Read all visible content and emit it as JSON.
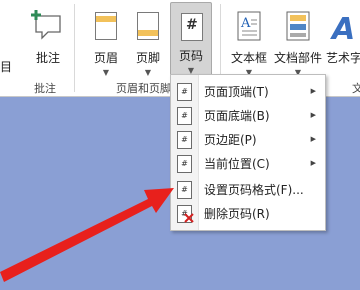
{
  "ribbon": {
    "left_cut_label": "目",
    "comment_btn": {
      "label": "批注"
    },
    "header_btn": {
      "label": "页眉"
    },
    "footer_btn": {
      "label": "页脚"
    },
    "pageno_btn": {
      "label": "页码",
      "icon_text": "#"
    },
    "textbox_btn": {
      "label": "文本框"
    },
    "docparts_btn": {
      "label": "文档部件"
    },
    "wordart_btn": {
      "label": "艺术字"
    },
    "group_comment": "批注",
    "group_header_footer": "页眉和页脚",
    "group_text_cut": "文"
  },
  "page_number_menu": {
    "items": [
      {
        "label": "页面顶端(T)",
        "has_submenu": true,
        "icon": "page-top-icon"
      },
      {
        "label": "页面底端(B)",
        "has_submenu": true,
        "icon": "page-bottom-icon"
      },
      {
        "label": "页边距(P)",
        "has_submenu": true,
        "icon": "page-margin-icon"
      },
      {
        "label": "当前位置(C)",
        "has_submenu": true,
        "icon": "current-position-icon"
      },
      {
        "label": "设置页码格式(F)...",
        "has_submenu": false,
        "icon": "format-page-number-icon"
      },
      {
        "label": "删除页码(R)",
        "has_submenu": false,
        "icon": "remove-page-number-icon"
      }
    ]
  },
  "colors": {
    "background": "#8a9fd4",
    "annotation_arrow": "#e8201c",
    "ribbon_accent": "#2e8b57"
  }
}
